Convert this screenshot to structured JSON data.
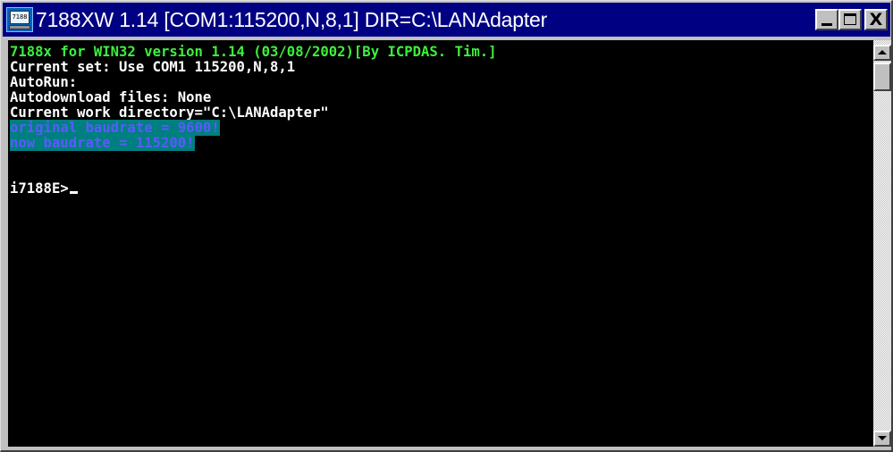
{
  "window": {
    "title": "7188XW 1.14 [COM1:115200,N,8,1] DIR=C:\\LANAdapter",
    "icon": "app-terminal-icon",
    "icon_label": "7188",
    "buttons": {
      "minimize": "minimize-icon",
      "maximize": "maximize-icon",
      "close": "close-icon",
      "close_glyph": "X"
    },
    "colors": {
      "titlebar": "#000082",
      "frame": "#c0c0c0"
    }
  },
  "console": {
    "colors": {
      "background": "#000000",
      "green_text": "#3cf03c",
      "white_text": "#ffffff",
      "selection_bg": "#007f80",
      "selection_fg": "#5a5aff"
    },
    "lines": [
      "7188x for WIN32 version 1.14 (03/08/2002)[By ICPDAS. Tim.]",
      "Current set: Use COM1 115200,N,8,1",
      "AutoRun:",
      "Autodownload files: None",
      "Current work directory=\"C:\\LANAdapter\"",
      "original baudrate = 9600!",
      "now baudrate = 115200!",
      "",
      "",
      "i7188E>"
    ]
  },
  "scrollbar": {
    "up": "scroll-up-arrow-icon",
    "down": "scroll-down-arrow-icon"
  }
}
